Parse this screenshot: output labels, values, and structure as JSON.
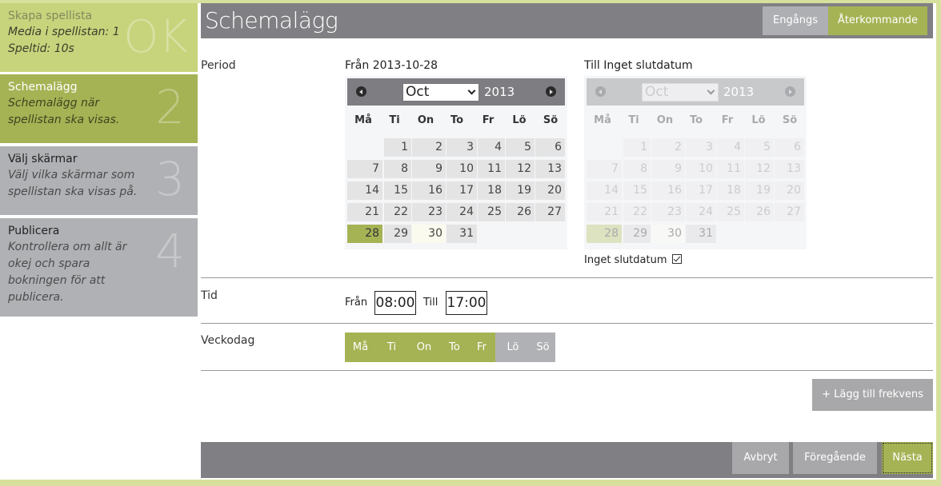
{
  "sidebar": {
    "steps": [
      {
        "title": "Skapa spellista",
        "desc_lines": [
          "Media i spellistan: 1",
          "Speltid: 10s"
        ],
        "badge": "OK",
        "state": "done"
      },
      {
        "title": "Schemalägg",
        "desc_lines": [
          "Schemalägg när",
          "spellistan ska visas."
        ],
        "badge": "2",
        "state": "active"
      },
      {
        "title": "Välj skärmar",
        "desc_lines": [
          "Välj vilka skärmar som",
          "spellistan ska visas på."
        ],
        "badge": "3",
        "state": "pending"
      },
      {
        "title": "Publicera",
        "desc_lines": [
          "Kontrollera om allt är",
          "okej och spara",
          "bokningen för att",
          "publicera."
        ],
        "badge": "4",
        "state": "pending"
      }
    ]
  },
  "header": {
    "title": "Schemalägg",
    "mode_tabs": [
      {
        "label": "Engångs",
        "active": false
      },
      {
        "label": "Återkommande",
        "active": true
      }
    ]
  },
  "period": {
    "label": "Period",
    "from": {
      "caption": "Från 2013-10-28",
      "month": "Oct",
      "year": "2013",
      "weekdays": [
        "Må",
        "Ti",
        "On",
        "To",
        "Fr",
        "Lö",
        "Sö"
      ],
      "first_weekday_index": 1,
      "days_in_month": 31,
      "selected_day": 28,
      "today": 30,
      "enabled": true
    },
    "to": {
      "caption": "Till Inget slutdatum",
      "month": "Oct",
      "year": "2013",
      "weekdays": [
        "Må",
        "Ti",
        "On",
        "To",
        "Fr",
        "Lö",
        "Sö"
      ],
      "first_weekday_index": 1,
      "days_in_month": 31,
      "selected_day": 28,
      "today": 30,
      "enabled": false
    },
    "no_end_date_label": "Inget slutdatum",
    "no_end_date_checked": true
  },
  "time": {
    "label": "Tid",
    "from_label": "Från",
    "from_value": "08:00",
    "to_label": "Till",
    "to_value": "17:00"
  },
  "weekday": {
    "label": "Veckodag",
    "days": [
      {
        "label": "Må",
        "on": true
      },
      {
        "label": "Ti",
        "on": true
      },
      {
        "label": "On",
        "on": true
      },
      {
        "label": "To",
        "on": true
      },
      {
        "label": "Fr",
        "on": true
      },
      {
        "label": "Lö",
        "on": false
      },
      {
        "label": "Sö",
        "on": false
      }
    ]
  },
  "add_frequency_label": "+ Lägg till frekvens",
  "footer": {
    "cancel": "Avbryt",
    "previous": "Föregående",
    "next": "Nästa"
  },
  "colors": {
    "accent_green": "#a5b354",
    "light_green": "#c7d47c",
    "frame_green": "#d7e09c",
    "gray_bar": "#808084",
    "gray_button": "#a8a8aa"
  }
}
